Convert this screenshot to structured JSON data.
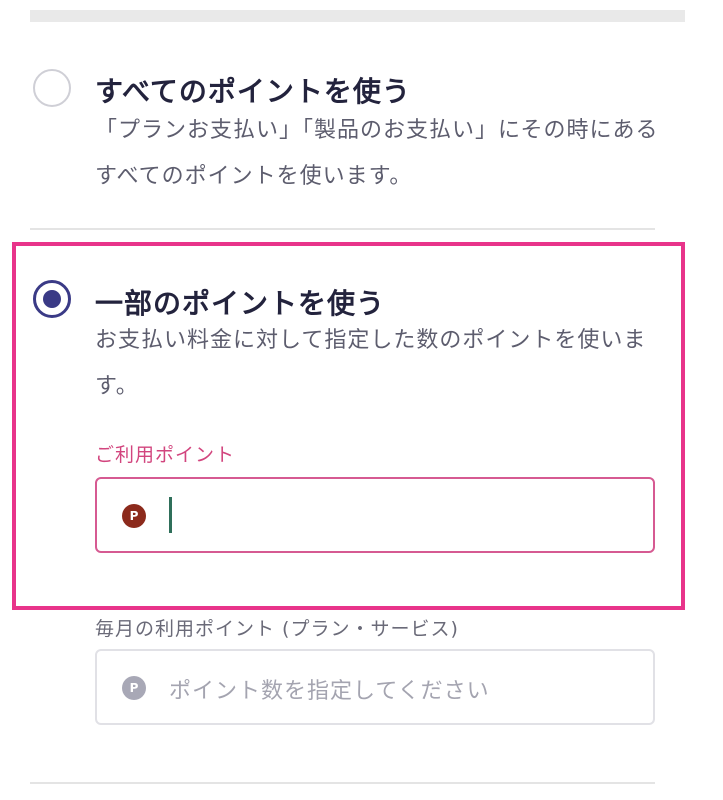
{
  "options": [
    {
      "title": "すべてのポイントを使う",
      "description": "「プランお支払い」「製品のお支払い」にその時にあるすべてのポイントを使います。",
      "selected": false
    },
    {
      "title": "一部のポイントを使う",
      "description": "お支払い料金に対して指定した数のポイントを使います。",
      "selected": true
    }
  ],
  "usage_points": {
    "label": "ご利用ポイント",
    "value": "",
    "icon": "point-badge-icon",
    "icon_letter": "P"
  },
  "monthly_points": {
    "label": "毎月の利用ポイント (プラン・サービス)",
    "placeholder": "ポイント数を指定してください",
    "icon": "point-badge-icon",
    "icon_letter": "P"
  },
  "colors": {
    "accent": "#3a3a86",
    "highlight": "#e8348a",
    "label_pink": "#d2457e",
    "point_icon": "#8c2a1c"
  }
}
